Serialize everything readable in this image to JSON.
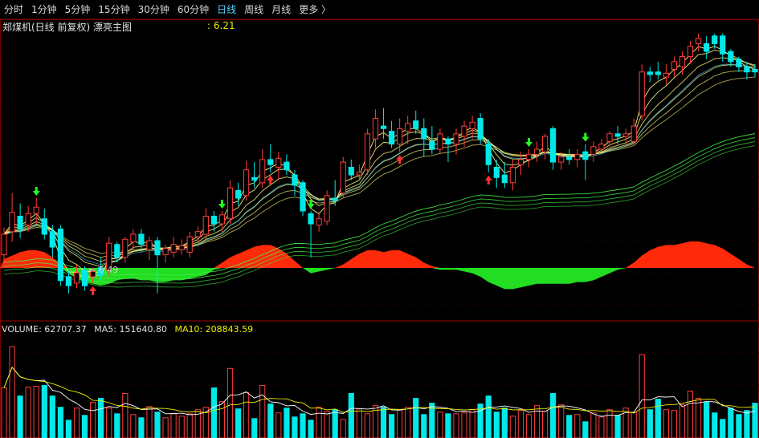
{
  "toolbar": {
    "tabs": [
      {
        "label": "分时",
        "active": false
      },
      {
        "label": "1分钟",
        "active": false
      },
      {
        "label": "5分钟",
        "active": false
      },
      {
        "label": "15分钟",
        "active": false
      },
      {
        "label": "30分钟",
        "active": false
      },
      {
        "label": "60分钟",
        "active": false
      },
      {
        "label": "日线",
        "active": true
      },
      {
        "label": "周线",
        "active": false
      },
      {
        "label": "月线",
        "active": false
      },
      {
        "label": "更多 〉",
        "active": false
      }
    ]
  },
  "main_panel": {
    "title": "郑煤机(日线 前复权) 漂亮主图",
    "price_readout": ": 6.21",
    "low_label": "← 6.49"
  },
  "volume_panel": {
    "volume_text": "VOLUME: 62707.37",
    "ma5_text": "MA5: 151640.80",
    "ma10_text": "MA10: 208843.59"
  },
  "colors": {
    "up_candle": "#ff3b3b",
    "down_candle": "#00e8e8",
    "osc_positive": "#ff2a0a",
    "osc_negative": "#22dd22",
    "ma_yellow": "#ffff80",
    "ma_green": "#44ee44",
    "ma_cyan": "#4fd5ff",
    "signal_up": "#ff3030",
    "signal_down": "#22ff22"
  },
  "chart_data": {
    "type": "candlestick",
    "price_range": [
      6.3,
      8.45
    ],
    "candles": [
      [
        6.72,
        6.93,
        6.65,
        6.88
      ],
      [
        6.9,
        7.2,
        6.82,
        7.05
      ],
      [
        7.02,
        7.12,
        6.85,
        6.92
      ],
      [
        6.95,
        7.1,
        6.9,
        7.04
      ],
      [
        7.04,
        7.16,
        6.96,
        7.09
      ],
      [
        7.0,
        7.08,
        6.84,
        6.88
      ],
      [
        6.9,
        6.95,
        6.7,
        6.78
      ],
      [
        6.92,
        6.95,
        6.48,
        6.52
      ],
      [
        6.55,
        6.6,
        6.42,
        6.48
      ],
      [
        6.5,
        6.64,
        6.46,
        6.58
      ],
      [
        6.6,
        6.63,
        6.44,
        6.48
      ],
      [
        6.55,
        6.62,
        6.5,
        6.59
      ],
      [
        6.62,
        6.7,
        6.52,
        6.56
      ],
      [
        6.6,
        6.86,
        6.55,
        6.81
      ],
      [
        6.8,
        6.82,
        6.66,
        6.7
      ],
      [
        6.7,
        6.86,
        6.66,
        6.84
      ],
      [
        6.82,
        6.92,
        6.76,
        6.88
      ],
      [
        6.88,
        6.92,
        6.74,
        6.8
      ],
      [
        6.76,
        6.86,
        6.68,
        6.83
      ],
      [
        6.83,
        6.86,
        6.42,
        6.72
      ],
      [
        6.72,
        6.8,
        6.66,
        6.77
      ],
      [
        6.74,
        6.86,
        6.7,
        6.8
      ],
      [
        6.76,
        6.84,
        6.72,
        6.79
      ],
      [
        6.74,
        6.9,
        6.7,
        6.86
      ],
      [
        6.86,
        6.94,
        6.82,
        6.9
      ],
      [
        6.88,
        7.08,
        6.84,
        7.02
      ],
      [
        7.02,
        7.06,
        6.9,
        6.96
      ],
      [
        6.96,
        7.06,
        6.9,
        7.03
      ],
      [
        7.0,
        7.3,
        6.96,
        7.24
      ],
      [
        7.22,
        7.28,
        7.1,
        7.16
      ],
      [
        7.18,
        7.45,
        7.14,
        7.38
      ],
      [
        7.32,
        7.44,
        7.24,
        7.3
      ],
      [
        7.28,
        7.54,
        7.24,
        7.46
      ],
      [
        7.46,
        7.58,
        7.36,
        7.42
      ],
      [
        7.4,
        7.52,
        7.3,
        7.47
      ],
      [
        7.44,
        7.5,
        7.34,
        7.38
      ],
      [
        7.34,
        7.38,
        7.18,
        7.26
      ],
      [
        7.28,
        7.3,
        7.02,
        7.06
      ],
      [
        7.04,
        7.06,
        6.7,
        6.96
      ],
      [
        6.95,
        7.05,
        6.9,
        7.0
      ],
      [
        6.98,
        7.22,
        6.95,
        7.18
      ],
      [
        7.16,
        7.3,
        7.1,
        7.14
      ],
      [
        7.2,
        7.48,
        7.16,
        7.44
      ],
      [
        7.4,
        7.46,
        7.3,
        7.34
      ],
      [
        7.34,
        7.42,
        7.3,
        7.36
      ],
      [
        7.38,
        7.7,
        7.34,
        7.66
      ],
      [
        7.62,
        7.85,
        7.55,
        7.78
      ],
      [
        7.72,
        7.86,
        7.62,
        7.7
      ],
      [
        7.68,
        7.76,
        7.55,
        7.58
      ],
      [
        7.58,
        7.78,
        7.52,
        7.7
      ],
      [
        7.68,
        7.8,
        7.58,
        7.74
      ],
      [
        7.76,
        7.84,
        7.66,
        7.7
      ],
      [
        7.7,
        7.78,
        7.48,
        7.62
      ],
      [
        7.6,
        7.72,
        7.5,
        7.54
      ],
      [
        7.54,
        7.7,
        7.5,
        7.66
      ],
      [
        7.62,
        7.64,
        7.44,
        7.58
      ],
      [
        7.58,
        7.7,
        7.5,
        7.66
      ],
      [
        7.64,
        7.76,
        7.56,
        7.72
      ],
      [
        7.7,
        7.8,
        7.62,
        7.75
      ],
      [
        7.78,
        7.82,
        7.58,
        7.62
      ],
      [
        7.58,
        7.62,
        7.36,
        7.42
      ],
      [
        7.4,
        7.46,
        7.24,
        7.32
      ],
      [
        7.34,
        7.44,
        7.24,
        7.28
      ],
      [
        7.28,
        7.46,
        7.22,
        7.4
      ],
      [
        7.42,
        7.52,
        7.34,
        7.46
      ],
      [
        7.46,
        7.54,
        7.4,
        7.5
      ],
      [
        7.5,
        7.6,
        7.44,
        7.54
      ],
      [
        7.52,
        7.66,
        7.46,
        7.64
      ],
      [
        7.7,
        7.72,
        7.38,
        7.44
      ],
      [
        7.44,
        7.52,
        7.38,
        7.48
      ],
      [
        7.48,
        7.54,
        7.42,
        7.46
      ],
      [
        7.46,
        7.54,
        7.4,
        7.5
      ],
      [
        7.52,
        7.58,
        7.3,
        7.46
      ],
      [
        7.5,
        7.6,
        7.44,
        7.56
      ],
      [
        7.54,
        7.62,
        7.52,
        7.58
      ],
      [
        7.6,
        7.68,
        7.56,
        7.66
      ],
      [
        7.66,
        7.72,
        7.58,
        7.64
      ],
      [
        7.64,
        7.7,
        7.56,
        7.66
      ],
      [
        7.6,
        7.78,
        7.58,
        7.72
      ],
      [
        7.8,
        8.2,
        7.76,
        8.14
      ],
      [
        8.14,
        8.18,
        8.06,
        8.12
      ],
      [
        8.14,
        8.22,
        8.08,
        8.12
      ],
      [
        8.1,
        8.2,
        8.04,
        8.13
      ],
      [
        8.16,
        8.26,
        8.1,
        8.22
      ],
      [
        8.18,
        8.3,
        8.12,
        8.26
      ],
      [
        8.26,
        8.38,
        8.2,
        8.34
      ],
      [
        8.36,
        8.44,
        8.3,
        8.4
      ],
      [
        8.36,
        8.42,
        8.24,
        8.3
      ],
      [
        8.42,
        8.44,
        8.32,
        8.36
      ],
      [
        8.42,
        8.44,
        8.22,
        8.28
      ],
      [
        8.3,
        8.32,
        8.18,
        8.22
      ],
      [
        8.24,
        8.26,
        8.14,
        8.18
      ],
      [
        8.18,
        8.22,
        8.08,
        8.14
      ],
      [
        8.16,
        8.2,
        8.1,
        8.14
      ]
    ],
    "oscillator": [
      0.5,
      0.7,
      0.9,
      1.0,
      1.0,
      0.9,
      0.6,
      0.2,
      -0.3,
      -0.6,
      -0.8,
      -0.9,
      -1.0,
      -0.9,
      -0.7,
      -0.6,
      -0.6,
      -0.7,
      -0.7,
      -0.8,
      -0.8,
      -0.7,
      -0.7,
      -0.6,
      -0.5,
      -0.4,
      -0.1,
      0.3,
      0.6,
      0.8,
      1.0,
      1.2,
      1.3,
      1.3,
      1.1,
      0.8,
      0.4,
      0.0,
      -0.3,
      -0.2,
      -0.1,
      0.0,
      0.2,
      0.5,
      0.8,
      1.0,
      1.0,
      0.9,
      1.0,
      1.0,
      0.8,
      0.6,
      0.3,
      0.1,
      -0.1,
      -0.1,
      -0.1,
      -0.2,
      -0.3,
      -0.5,
      -0.8,
      -1.0,
      -1.2,
      -1.2,
      -1.1,
      -1.0,
      -0.9,
      -0.9,
      -0.9,
      -0.9,
      -0.9,
      -0.8,
      -0.8,
      -0.7,
      -0.5,
      -0.3,
      -0.1,
      0.0,
      0.3,
      0.7,
      1.0,
      1.2,
      1.3,
      1.3,
      1.4,
      1.5,
      1.5,
      1.4,
      1.3,
      1.1,
      0.8,
      0.5,
      0.2,
      0.0
    ],
    "volume_range": [
      0,
      120000
    ],
    "volume": [
      62000,
      113000,
      52000,
      63000,
      64000,
      65000,
      52000,
      38000,
      22000,
      37000,
      28000,
      44000,
      49000,
      37000,
      30000,
      55000,
      29000,
      25000,
      39000,
      32000,
      25000,
      30000,
      27000,
      30000,
      35000,
      38000,
      62000,
      45000,
      86000,
      36000,
      56000,
      24000,
      65000,
      42000,
      31000,
      37000,
      26000,
      30000,
      22000,
      38000,
      33000,
      35000,
      23000,
      55000,
      36000,
      30000,
      40000,
      38000,
      29000,
      35000,
      38000,
      49000,
      29000,
      43000,
      32000,
      30000,
      30000,
      31000,
      35000,
      42000,
      52000,
      32000,
      37000,
      27000,
      34000,
      29000,
      40000,
      33000,
      55000,
      41000,
      28000,
      29000,
      20000,
      31000,
      26000,
      35000,
      28000,
      37000,
      32000,
      103000,
      35000,
      48000,
      35000,
      34000,
      41000,
      58000,
      49000,
      44000,
      31000,
      23000,
      37000,
      29000,
      34000,
      43000
    ],
    "signals": [
      {
        "index": 4,
        "type": "down"
      },
      {
        "index": 11,
        "type": "up"
      },
      {
        "index": 27,
        "type": "down"
      },
      {
        "index": 33,
        "type": "up"
      },
      {
        "index": 38,
        "type": "down"
      },
      {
        "index": 49,
        "type": "up"
      },
      {
        "index": 60,
        "type": "up"
      },
      {
        "index": 65,
        "type": "down"
      },
      {
        "index": 72,
        "type": "down"
      }
    ]
  }
}
